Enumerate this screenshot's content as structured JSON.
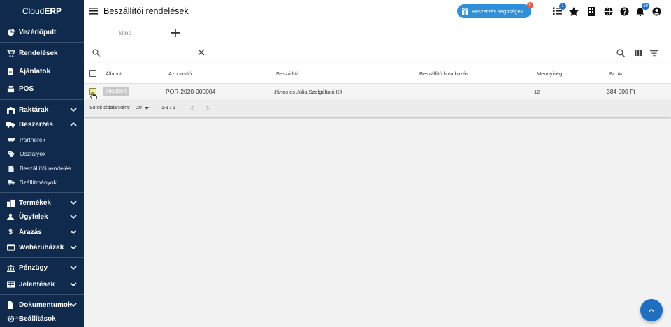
{
  "app": {
    "brand_prefix": "Cloud",
    "brand_suffix": "ERP"
  },
  "sidebar": {
    "items": [
      {
        "label": "Vezérlőpult",
        "icon": "dashboard-icon"
      },
      {
        "label": "Rendelések",
        "icon": "cart-icon"
      },
      {
        "label": "Ajánlatok",
        "icon": "document-icon"
      },
      {
        "label": "POS",
        "icon": "register-icon"
      },
      {
        "label": "Raktárak",
        "icon": "warehouse-icon"
      },
      {
        "label": "Beszerzés",
        "icon": "truck-icon"
      },
      {
        "label": "Termékek",
        "icon": "products-icon"
      },
      {
        "label": "Ügyfelek",
        "icon": "users-icon"
      },
      {
        "label": "Árazás",
        "icon": "dollar-icon"
      },
      {
        "label": "Webáruházak",
        "icon": "store-icon"
      },
      {
        "label": "Pénzügy",
        "icon": "bank-icon"
      },
      {
        "label": "Jelentések",
        "icon": "report-icon"
      },
      {
        "label": "Dokumentumok",
        "icon": "file-icon"
      },
      {
        "label": "Beállítások",
        "icon": "gear-icon"
      }
    ],
    "sub_items": [
      {
        "label": "Partnerek",
        "icon": "handshake-icon"
      },
      {
        "label": "Osztályok",
        "icon": "tag-icon"
      },
      {
        "label": "Beszállítói rendelés",
        "icon": "document-icon"
      },
      {
        "label": "Szállítmányok",
        "icon": "truck-icon"
      }
    ],
    "watermark": "This demo is unstable"
  },
  "topbar": {
    "title": "Beszállítói rendelések",
    "help_button": "Beszerzés segítségek",
    "help_badge": "0",
    "tasks_badge": "1",
    "notifications_badge": "50"
  },
  "tabs": {
    "all": "Mind"
  },
  "search": {
    "value": "",
    "placeholder": ""
  },
  "table": {
    "headers": {
      "status": "Állapot",
      "id": "Azonosító",
      "supplier": "Beszállító",
      "supplier_ref": "Beszállító hivatkozás",
      "quantity": "Mennyiség",
      "gross_price": "Br. Ár"
    },
    "rows": [
      {
        "status": "elküldött",
        "id": "POR-2020-000004",
        "supplier": "János és Júlia Szolgáltató Kft",
        "supplier_ref": "",
        "quantity": "12",
        "gross_price": "384 000 Ft"
      }
    ],
    "footer": {
      "rows_per_page_label": "Sorok oldalanként:",
      "rows_per_page_value": "20",
      "range": "1-1 / 1"
    }
  },
  "colors": {
    "sidebar_bg": "#0f2a4d",
    "accent": "#2f8fd8",
    "badge": "#1c6fd1",
    "fab": "#1f6fc0"
  }
}
